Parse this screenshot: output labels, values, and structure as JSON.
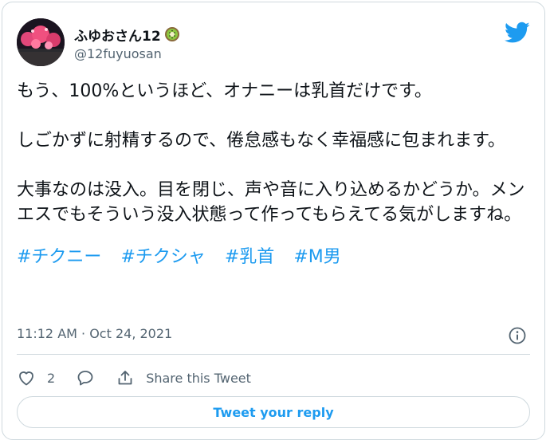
{
  "author": {
    "display_name": "ふゆおさん12",
    "handle": "@12fuyuosan",
    "badge_icon": "kiwi-emoji-icon",
    "avatar_icon": "avatar-photo-icon"
  },
  "brand": {
    "logo_icon": "twitter-bird-icon",
    "accent_color": "#1d9bf0"
  },
  "tweet": {
    "paragraphs": [
      "もう、100%というほど、オナニーは乳首だけです。",
      "しごかずに射精するので、倦怠感もなく幸福感に包まれます。",
      "大事なのは没入。目を閉じ、声や音に入り込めるかどうか。メンエスでもそういう没入状態って作ってもらえてる気がしますね。"
    ],
    "hashtags": [
      "#チクニー",
      "#チクシャ",
      "#乳首",
      "#M男"
    ],
    "timestamp": "11:12 AM · Oct 24, 2021",
    "info_icon": "info-circle-icon"
  },
  "actions": {
    "like_count": "2",
    "like_icon": "heart-icon",
    "reply_icon": "speech-bubble-icon",
    "share_icon": "share-upload-icon",
    "share_label": "Share this Tweet"
  },
  "reply": {
    "label": "Tweet your reply"
  }
}
